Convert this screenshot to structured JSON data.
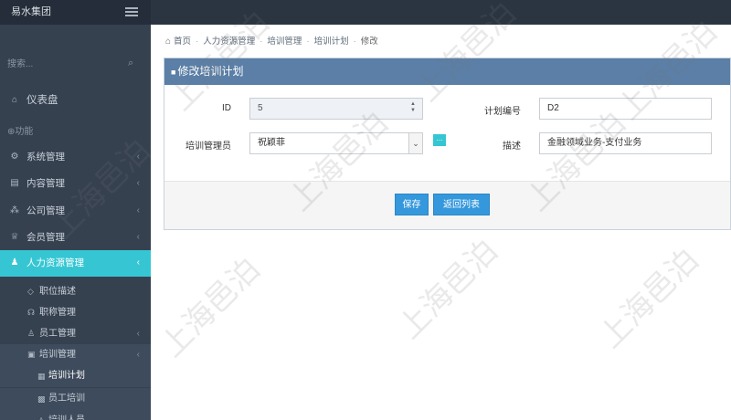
{
  "brand": "易水集团",
  "search": {
    "placeholder": "搜索..."
  },
  "sidebar": {
    "dashboard": "仪表盘",
    "section": "功能",
    "items": [
      {
        "label": "系统管理",
        "icon": "gears-icon"
      },
      {
        "label": "内容管理",
        "icon": "list-icon"
      },
      {
        "label": "公司管理",
        "icon": "sitemap-icon"
      },
      {
        "label": "会员管理",
        "icon": "trophy-icon"
      },
      {
        "label": "人力资源管理",
        "icon": "users-icon"
      }
    ],
    "hr_children": [
      {
        "label": "职位描述",
        "icon": "diamond-icon"
      },
      {
        "label": "职称管理",
        "icon": "headset-icon"
      },
      {
        "label": "员工管理",
        "icon": "user-icon"
      },
      {
        "label": "培训管理",
        "icon": "briefcase-icon"
      }
    ],
    "training_children": [
      {
        "label": "培训计划",
        "icon": "table-icon"
      },
      {
        "label": "员工培训",
        "icon": "grid-icon"
      },
      {
        "label": "培训人员",
        "icon": "user-icon"
      }
    ]
  },
  "breadcrumb": {
    "items": [
      "首页",
      "人力资源管理",
      "培训管理",
      "培训计划",
      "修改"
    ]
  },
  "panel": {
    "title": "修改培训计划"
  },
  "form": {
    "id_label": "ID",
    "id_value": "5",
    "plan_no_label": "计划编号",
    "plan_no_value": "D2",
    "manager_label": "培训管理员",
    "manager_value": "祝颖菲",
    "desc_label": "描述",
    "desc_value": "金融领域业务-支付业务",
    "pick_button": "..."
  },
  "buttons": {
    "save": "保存",
    "back": "返回列表"
  },
  "watermark": "上海邑泊",
  "colors": {
    "accent": "#36c6d3",
    "header": "#5b7fa6",
    "sidebar": "#364150",
    "primary_btn": "#3598dc"
  }
}
